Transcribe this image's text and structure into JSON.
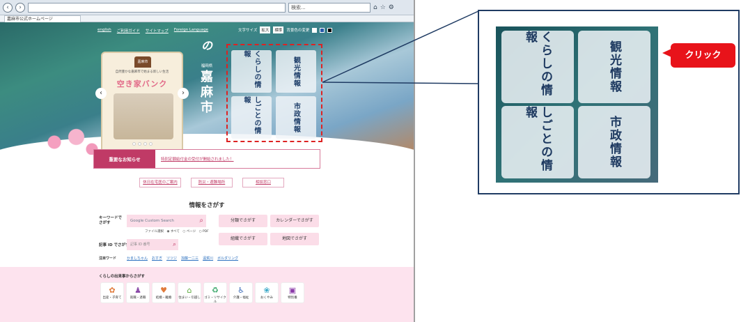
{
  "browser": {
    "address": "",
    "search_placeholder": "検索...",
    "tab_title": "嘉麻市公式ホームページ"
  },
  "header": {
    "nav": [
      "english",
      "ご利用ガイド",
      "サイトマップ",
      "Foreign Language"
    ],
    "size_label": "文字サイズ",
    "size_large": "拡大",
    "size_standard": "標準",
    "color_label": "背景色の変更"
  },
  "banner": {
    "emblem": "嘉麻市",
    "subtitle": "自然豊かな嘉麻市で始まる新しい生活",
    "title": "空き家バンク"
  },
  "logo": {
    "prefecture": "福岡県",
    "city": "嘉麻市"
  },
  "quick_tiles": [
    "くらしの情報",
    "観光情報",
    "しごとの情報",
    "市政情報"
  ],
  "notice": {
    "label": "重要なお知らせ",
    "text": "特別定額給付金の受付が開始されました！"
  },
  "pink_buttons": [
    "休日在宅医のご案内",
    "防災・避難場所",
    "相談窓口"
  ],
  "search_section": {
    "title": "情報をさがす",
    "keyword_label": "キーワードでさがす",
    "google_placeholder": "Google Custom Search",
    "file_type": "ファイル選択　◉ すべて　○ ページ　○ PDF",
    "id_label": "記事 ID でさがす",
    "id_placeholder": "記事 ID 番号",
    "buttons": [
      "分類でさがす",
      "カレンダーでさがす",
      "組織でさがす",
      "地図でさがす"
    ],
    "attention_label": "注目ワード",
    "attention_words": [
      "かましちゃん",
      "おすぎ",
      "ツツジ",
      "加藤一二三",
      "遠賀川",
      "ボルダリング"
    ]
  },
  "life": {
    "title": "くらしの出来事からさがす",
    "items": [
      {
        "label": "出産・子育て",
        "icon": "baby-icon",
        "glyph": "✿"
      },
      {
        "label": "就職・退職",
        "icon": "work-icon",
        "glyph": "♟"
      },
      {
        "label": "結婚・離婚",
        "icon": "couple-icon",
        "glyph": "♥"
      },
      {
        "label": "住まい・引越し",
        "icon": "house-icon",
        "glyph": "⌂"
      },
      {
        "label": "ゴミ・リサイクル",
        "icon": "trash-icon",
        "glyph": "♻"
      },
      {
        "label": "介護・福祉",
        "icon": "wheelchair-icon",
        "glyph": "♿"
      },
      {
        "label": "おくやみ",
        "icon": "flower-icon",
        "glyph": "❀"
      },
      {
        "label": "特別養",
        "icon": "bus-icon",
        "glyph": "▣"
      }
    ]
  },
  "zoom_tiles": [
    "くらしの情報",
    "観光情報",
    "しごとの情報",
    "市政情報"
  ],
  "click_label": "クリック",
  "colors": {
    "accent": "#c03a66",
    "callout_border": "#1f3b63",
    "click": "#e8131a"
  }
}
